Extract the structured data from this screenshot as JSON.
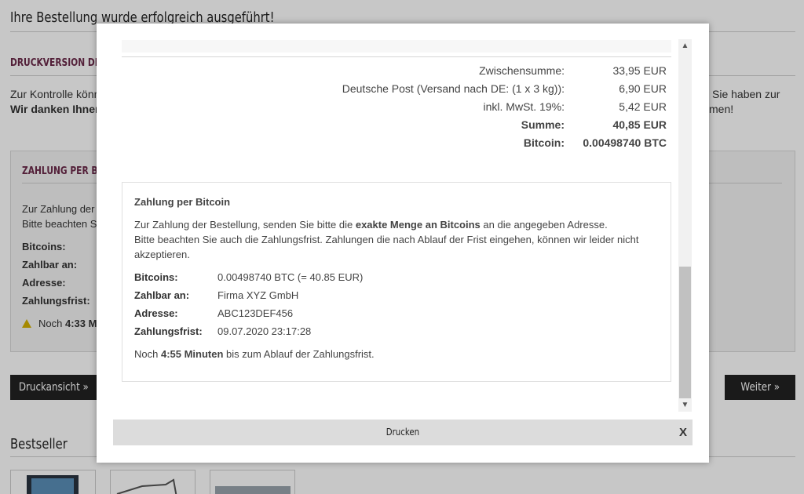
{
  "background": {
    "title": "Ihre Bestellung wurde erfolgreich ausgeführt!",
    "print_heading": "DRUCKVERSION DER B",
    "control_line": "Zur Kontrolle könne",
    "thanks_line": "Wir danken Ihnen",
    "right_line1": "Sie haben zur",
    "right_line2": "men!",
    "payment_heading": "ZAHLUNG PER BITC",
    "payment_line1": "Zur Zahlung der",
    "payment_line2": "Bitte beachten S",
    "labels": [
      "Bitcoins:",
      "Zahlbar an:",
      "Adresse:",
      "Zahlungsfrist:"
    ],
    "warn_prefix": "Noch",
    "warn_time": "4:33 M",
    "print_view_button": "Druckansicht »",
    "next_button": "Weiter »",
    "bestseller_heading": "Bestseller"
  },
  "modal": {
    "summary": [
      {
        "label": "Zwischensumme:",
        "value": "33,95 EUR",
        "bold": false
      },
      {
        "label": "Deutsche Post (Versand nach DE: (1 x 3 kg)):",
        "value": "6,90 EUR",
        "bold": false
      },
      {
        "label": "inkl. MwSt. 19%:",
        "value": "5,42 EUR",
        "bold": false
      },
      {
        "label": "Summe:",
        "value": "40,85 EUR",
        "bold": true
      },
      {
        "label": "Bitcoin:",
        "value": "0.00498740 BTC",
        "bold": true
      }
    ],
    "payment": {
      "title": "Zahlung per Bitcoin",
      "line1_pre": "Zur Zahlung der Bestellung, senden Sie bitte die ",
      "line1_bold": "exakte Menge an Bitcoins",
      "line1_post": " an die angegeben Adresse.",
      "line2": "Bitte beachten Sie auch die Zahlungsfrist. Zahlungen die nach Ablauf der Frist eingehen, können wir leider nicht",
      "line3": "akzeptieren.",
      "details": [
        {
          "label": "Bitcoins:",
          "value": "0.00498740 BTC (= 40.85 EUR)"
        },
        {
          "label": "Zahlbar an:",
          "value": "Firma XYZ GmbH"
        },
        {
          "label": "Adresse:",
          "value": "ABC123DEF456"
        },
        {
          "label": "Zahlungsfrist:",
          "value": "09.07.2020 23:17:28"
        }
      ],
      "countdown_pre": "Noch ",
      "countdown_time": "4:55 Minuten",
      "countdown_post": " bis zum Ablauf der Zahlungsfrist."
    },
    "print_button": "Drucken",
    "close_label": "X"
  },
  "icons": {
    "warning": "warning-icon",
    "scroll_up": "chevron-up-icon",
    "scroll_down": "chevron-down-icon",
    "close": "close-icon"
  },
  "colors": {
    "heading_accent": "#6b2a4a",
    "button_dark": "#222222",
    "footer_bar": "#dcdcdc"
  }
}
